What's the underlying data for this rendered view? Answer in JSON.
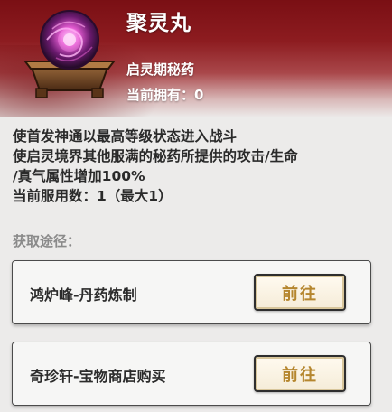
{
  "item": {
    "name": "聚灵丸",
    "type": "启灵期秘药",
    "owned": "当前拥有：0",
    "icon": "glowing-pill-on-stand-icon"
  },
  "description": {
    "lines": [
      "使首发神通以最高等级状态进入战斗",
      "使启灵境界其他服满的秘药所提供的攻击/生命",
      "/真气属性增加100%",
      "当前服用数：1（最大1）"
    ]
  },
  "sources": {
    "title": "获取途径：",
    "items": [
      {
        "label": "鸿炉峰-丹药炼制",
        "button": "前往"
      },
      {
        "label": "奇珍轩-宝物商店购买",
        "button": "前往"
      }
    ]
  },
  "colors": {
    "header_red": "#8d1c20",
    "button_text_gold": "#b5862e",
    "background": "#ecebea"
  }
}
